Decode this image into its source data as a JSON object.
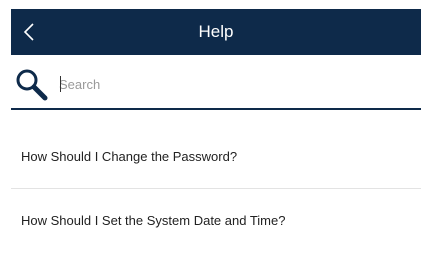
{
  "header": {
    "title": "Help",
    "back_icon": "chevron-left-icon"
  },
  "search": {
    "icon": "search-icon",
    "placeholder": "Search",
    "value": ""
  },
  "help_items": [
    {
      "label": "How Should I Change the Password?"
    },
    {
      "label": "How Should I Set the System Date and Time?"
    }
  ],
  "colors": {
    "header_bg": "#0e2a4a",
    "header_text": "#ffffff",
    "search_underline": "#0e2a4a",
    "divider": "#e3e3e3",
    "item_text": "#222222"
  }
}
